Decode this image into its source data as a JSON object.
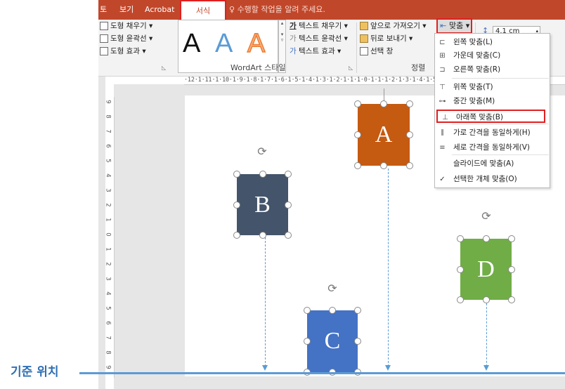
{
  "tabs": {
    "items": [
      "토",
      "보기",
      "Acrobat",
      "서식"
    ],
    "active": "서식",
    "tell_me": "수행할 작업을 알려 주세요."
  },
  "ribbon": {
    "shape_styles": {
      "fill": "도형 채우기",
      "outline": "도형 윤곽선",
      "effects": "도형 효과"
    },
    "wordart": {
      "letters": [
        "A",
        "A",
        "A"
      ],
      "text_fill": "텍스트 채우기",
      "text_outline": "텍스트 윤곽선",
      "text_effects": "텍스트 효과",
      "group_label": "WordArt 스타일"
    },
    "arrange": {
      "bring_forward": "앞으로 가져오기",
      "send_backward": "뒤로 보내기",
      "selection_pane": "선택 창",
      "align": "맞춤",
      "group_label": "정렬"
    },
    "size": {
      "height_value": "4.1 cm"
    }
  },
  "ruler": {
    "horizontal": "·12·1·11·1·10·1·9·1·8·1·7·1·6·1·5·1·4·1·3·1·2·1·1·1·0·1·1·1·2·1·3·1·4·1·5·1·6·1·7·1·8·1·9·1·10·1·11·1·12·",
    "vertical": [
      "9",
      "8",
      "7",
      "6",
      "5",
      "4",
      "3",
      "2",
      "1",
      "0",
      "1",
      "2",
      "3",
      "4",
      "5",
      "6",
      "7",
      "8",
      "9"
    ]
  },
  "align_menu": {
    "items": [
      {
        "icon": "align-left-icon",
        "label": "왼쪽 맞춤(L)"
      },
      {
        "icon": "align-center-icon",
        "label": "가운데 맞춤(C)"
      },
      {
        "icon": "align-right-icon",
        "label": "오른쪽 맞춤(R)"
      },
      {
        "icon": "align-top-icon",
        "label": "위쪽 맞춤(T)"
      },
      {
        "icon": "align-middle-icon",
        "label": "중간 맞춤(M)"
      },
      {
        "icon": "align-bottom-icon",
        "label": "아래쪽 맞춤(B)",
        "highlighted": true
      },
      {
        "icon": "distribute-horizontal-icon",
        "label": "가로 간격을 동일하게(H)"
      },
      {
        "icon": "distribute-vertical-icon",
        "label": "세로 간격을 동일하게(V)"
      },
      {
        "icon": "",
        "label": "슬라이드에 맞춤(A)"
      },
      {
        "icon": "checkmark-icon",
        "label": "선택한 개체 맞춤(O)"
      }
    ]
  },
  "shapes": [
    {
      "label": "A",
      "color": "#c55a11"
    },
    {
      "label": "B",
      "color": "#44546a"
    },
    {
      "label": "C",
      "color": "#4472c4"
    },
    {
      "label": "D",
      "color": "#70ad47"
    }
  ],
  "annotation": {
    "baseline_label": "기준 위치",
    "baseline_color": "#5b9bd5"
  },
  "colors": {
    "tab_bar": "#c1472b",
    "highlight": "#e02020"
  }
}
